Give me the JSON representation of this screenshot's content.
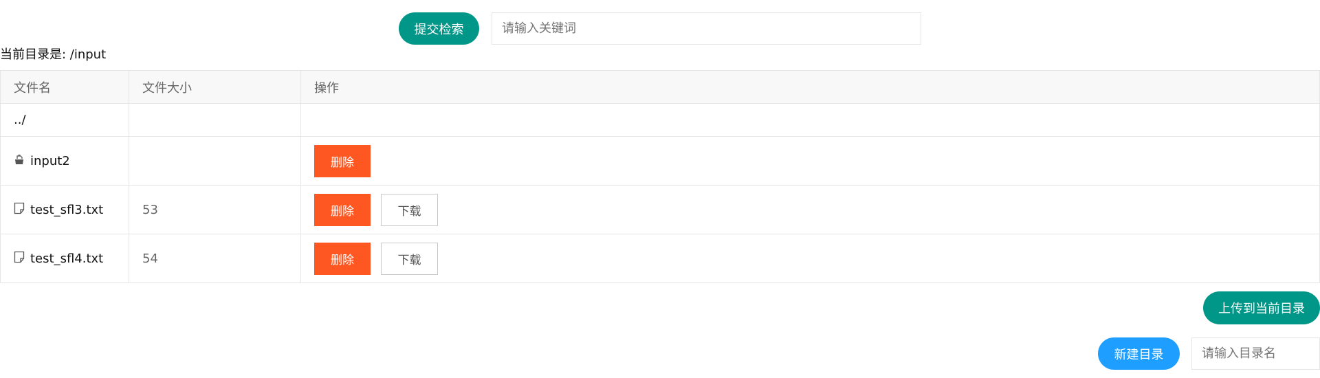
{
  "search": {
    "button_label": "提交检索",
    "placeholder": "请输入关键词",
    "value": ""
  },
  "current_dir": {
    "label": "当前目录是: /input"
  },
  "table": {
    "headers": [
      "文件名",
      "文件大小",
      "操作"
    ],
    "parent_link": "../",
    "rows": [
      {
        "icon": "folder-icon",
        "name": "input2",
        "size": "",
        "delete_label": "删除",
        "download_label": ""
      },
      {
        "icon": "file-icon",
        "name": "test_sfl3.txt",
        "size": "53",
        "delete_label": "删除",
        "download_label": "下载"
      },
      {
        "icon": "file-icon",
        "name": "test_sfl4.txt",
        "size": "54",
        "delete_label": "删除",
        "download_label": "下载"
      }
    ]
  },
  "upload": {
    "button_label": "上传到当前目录"
  },
  "mkdir": {
    "button_label": "新建目录",
    "placeholder": "请输入目录名",
    "value": ""
  },
  "colors": {
    "teal": "#009688",
    "blue": "#1e9fff",
    "danger": "#ff5722",
    "border": "#e6e6e6",
    "header_bg": "#f8f8f8"
  }
}
